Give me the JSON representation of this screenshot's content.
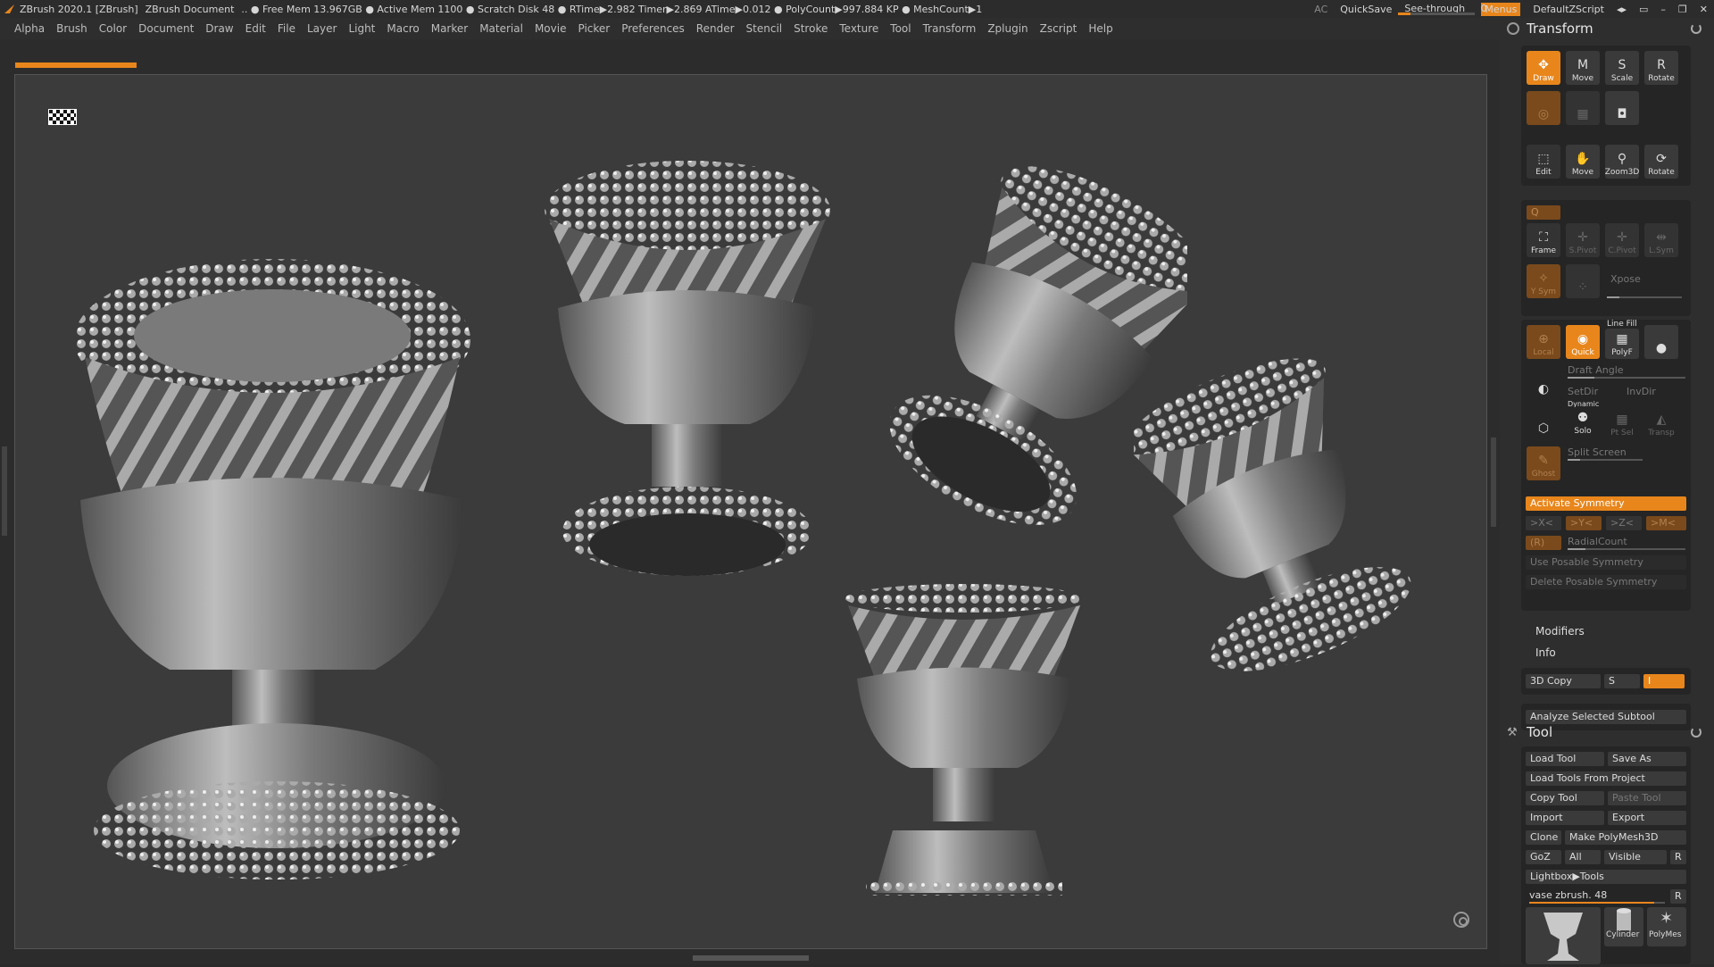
{
  "titlebar": {
    "app": "ZBrush 2020.1 [ZBrush]",
    "document": "ZBrush Document",
    "stats": ".. ● Free Mem 13.967GB ● Active Mem 1100 ● Scratch Disk 48 ● RTime▶2.982 Timer▶2.869 ATime▶0.012 ● PolyCount▶997.884 KP ● MeshCount▶1",
    "ac": "AC",
    "quicksave": "QuickSave",
    "see_through_label": "See-through",
    "see_through_value": "0",
    "menus": "Menus",
    "script": "DefaultZScript"
  },
  "menubar": [
    "Alpha",
    "Brush",
    "Color",
    "Document",
    "Draw",
    "Edit",
    "File",
    "Layer",
    "Light",
    "Macro",
    "Marker",
    "Material",
    "Movie",
    "Picker",
    "Preferences",
    "Render",
    "Stencil",
    "Stroke",
    "Texture",
    "Tool",
    "Transform",
    "Zplugin",
    "Zscript",
    "Help"
  ],
  "transform": {
    "title": "Transform",
    "row1": [
      "Draw",
      "Move",
      "Scale",
      "Rotate"
    ],
    "row3": [
      "Edit",
      "Move",
      "Zoom3D",
      "Rotate"
    ],
    "xyz": "Q",
    "row5": [
      "Frame",
      "S.Pivot",
      "C.Pivot",
      "L.Sym"
    ],
    "row6": [
      "Y Sym",
      "Xpose"
    ],
    "xpose": "Xpose",
    "row7": [
      "Local",
      "Quick",
      "PolyF"
    ],
    "line_fill": "Line Fill",
    "draft_angle": "Draft Angle",
    "setdir": "SetDir",
    "invdir": "InvDir",
    "dynamic": "Dynamic",
    "solo": "Solo",
    "ptsel": "Pt Sel",
    "transp": "Transp",
    "split_screen": "Split Screen",
    "ghost": "Ghost",
    "activate_symmetry": "Activate Symmetry",
    "sym_axes": [
      ">X<",
      ">Y<",
      ">Z<",
      ">M<"
    ],
    "radial_r": "(R)",
    "radial_count": "RadialCount",
    "use_posable": "Use Posable Symmetry",
    "delete_posable": "Delete Posable Symmetry",
    "modifiers": "Modifiers",
    "info": "Info",
    "copy3d": "3D Copy",
    "copy3d_s": "S",
    "copy3d_i": "I",
    "analyze": "Analyze Selected Subtool"
  },
  "tool": {
    "title": "Tool",
    "load_tool": "Load Tool",
    "save_as": "Save As",
    "load_from_project": "Load Tools From Project",
    "copy_tool": "Copy Tool",
    "paste_tool": "Paste Tool",
    "import": "Import",
    "export": "Export",
    "clone": "Clone",
    "make_polymesh": "Make PolyMesh3D",
    "goz": "GoZ",
    "all": "All",
    "visible": "Visible",
    "r": "R",
    "lightbox": "Lightbox▶Tools",
    "current_tool": "vase zbrush. 48",
    "thumbs": [
      "Cylinder",
      "PolyMes"
    ]
  }
}
